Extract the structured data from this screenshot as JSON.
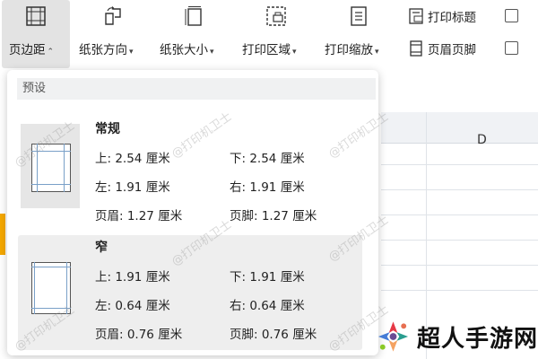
{
  "toolbar": {
    "margins_label": "页边距",
    "orientation_label": "纸张方向",
    "size_label": "纸张大小",
    "print_area_label": "打印区域",
    "print_scale_label": "打印缩放",
    "print_titles_label": "打印标题",
    "header_footer_label": "页眉页脚"
  },
  "sheet": {
    "column_d": "D"
  },
  "dropdown": {
    "section_title": "预设",
    "presets": [
      {
        "name": "常规",
        "top": "上: 2.54 厘米",
        "bottom": "下: 2.54 厘米",
        "left": "左: 1.91 厘米",
        "right": "右: 1.91 厘米",
        "header": "页眉: 1.27 厘米",
        "footer": "页脚: 1.27 厘米"
      },
      {
        "name": "窄",
        "top": "上: 1.91 厘米",
        "bottom": "下: 1.91 厘米",
        "left": "左: 0.64 厘米",
        "right": "右: 0.64 厘米",
        "header": "页眉: 0.76 厘米",
        "footer": "页脚: 0.76 厘米"
      }
    ]
  },
  "watermark": "@打印机卫士",
  "logo": {
    "text": "超人手游网"
  },
  "colors": {
    "accent": "#f5a800",
    "margin_line": "#7aa0c8"
  }
}
